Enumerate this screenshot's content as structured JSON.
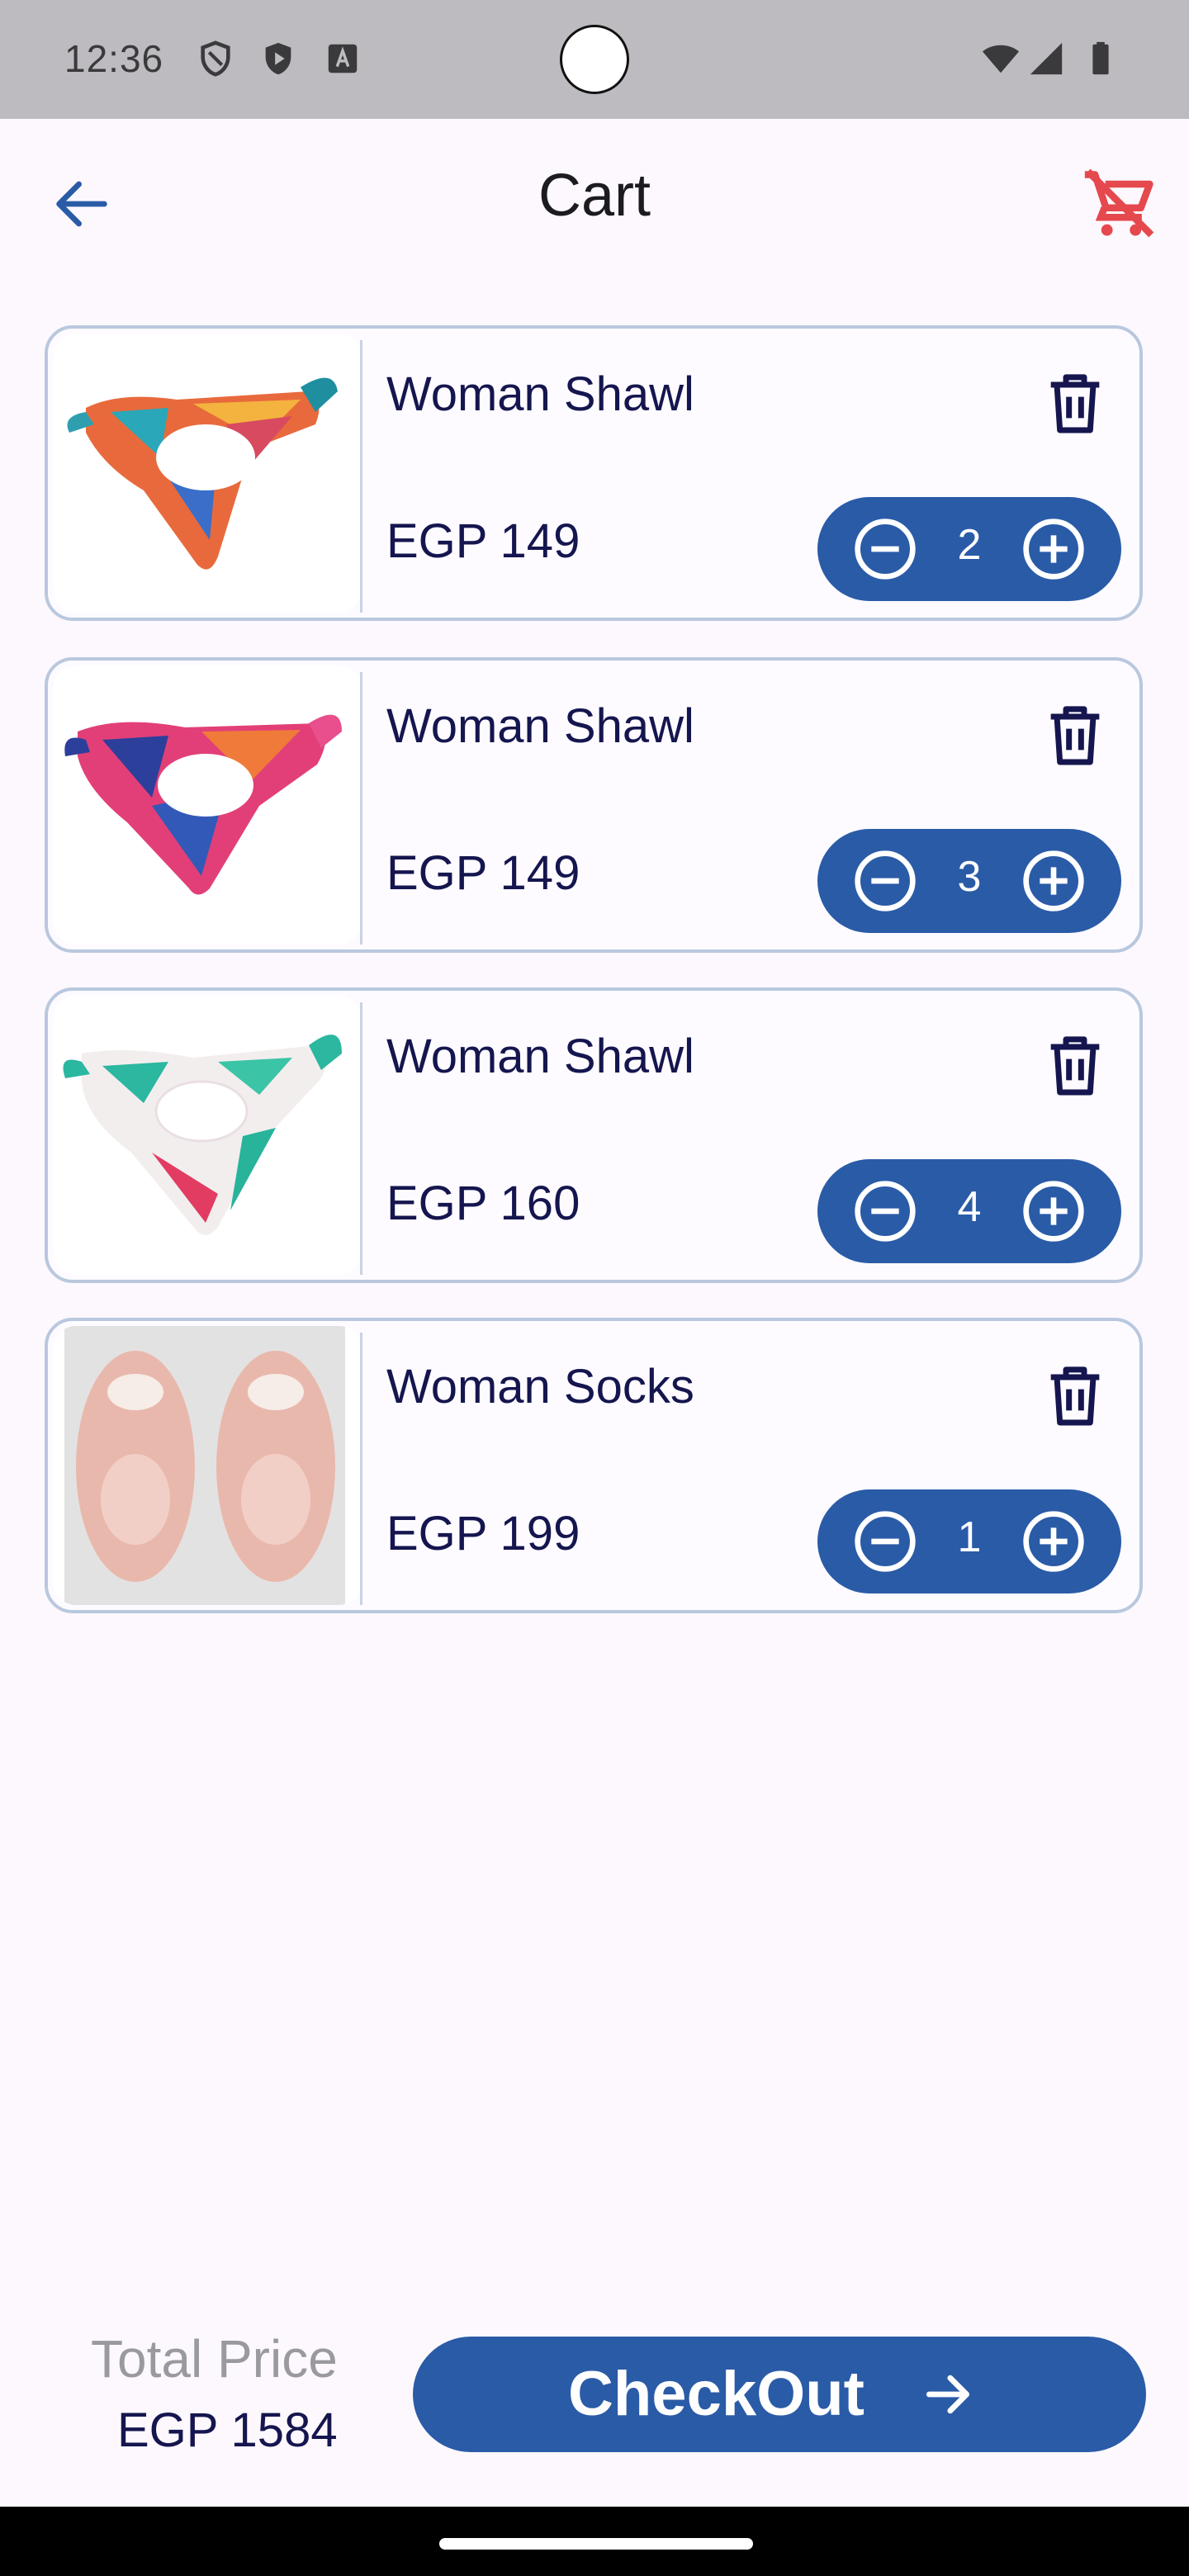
{
  "status_bar": {
    "time": "12:36",
    "icons": [
      "vpn-shield-icon",
      "play-protect-icon",
      "accessibility-a-icon",
      "wifi-icon",
      "signal-icon",
      "battery-icon"
    ]
  },
  "header": {
    "title": "Cart",
    "back_icon": "arrow-back-icon",
    "clear_cart_icon": "remove-shopping-cart-icon"
  },
  "cart": {
    "items": [
      {
        "name": "Woman Shawl",
        "price": "EGP 149",
        "quantity": "2"
      },
      {
        "name": "Woman Shawl",
        "price": "EGP 149",
        "quantity": "3"
      },
      {
        "name": "Woman Shawl",
        "price": "EGP 160",
        "quantity": "4"
      },
      {
        "name": "Woman Socks",
        "price": "EGP 199",
        "quantity": "1"
      }
    ]
  },
  "footer": {
    "total_label": "Total Price",
    "total_value": "EGP 1584",
    "checkout_label": "CheckOut"
  },
  "colors": {
    "primary": "#2a5ba7",
    "text_dark": "#15154f",
    "danger": "#e5484d",
    "card_border": "#b9c8de"
  }
}
